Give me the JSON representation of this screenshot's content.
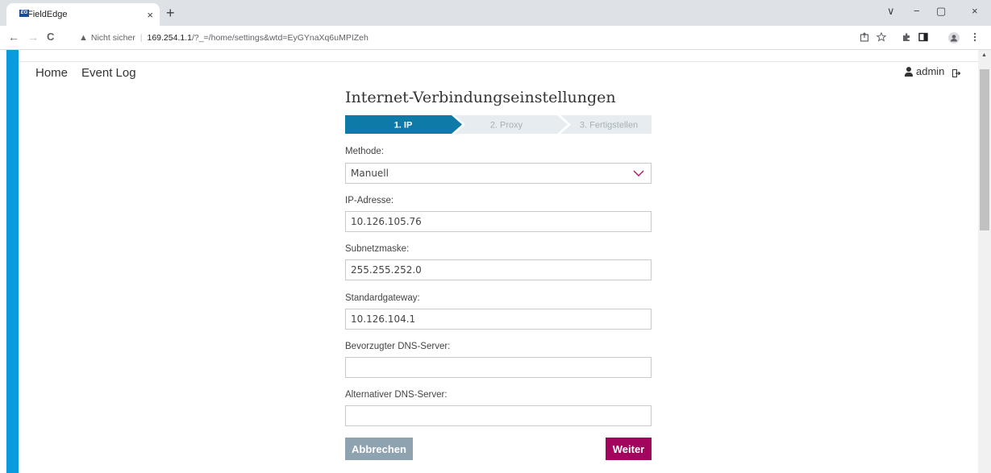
{
  "browser": {
    "tab_title": "FieldEdge",
    "tab_favicon_text": "EG",
    "tab_close": "×",
    "new_tab": "+",
    "back": "←",
    "forward": "→",
    "reload": "C",
    "security_icon": "▲",
    "security_text": "Nicht sicher",
    "separator": "|",
    "url_host": "169.254.1.1",
    "url_path": "/?_=/home/settings&wtd=EyGYnaXq6uMPIZeh",
    "window_controls": {
      "minimize": "−",
      "maximize": "▢",
      "close": "×",
      "tab_search": "∨"
    }
  },
  "nav": {
    "home": "Home",
    "event_log": "Event Log"
  },
  "user": {
    "name": "admin"
  },
  "form": {
    "title": "Internet-Verbindungseinstellungen",
    "steps": [
      {
        "label": "1. IP",
        "active": true
      },
      {
        "label": "2. Proxy",
        "active": false
      },
      {
        "label": "3. Fertigstellen",
        "active": false
      }
    ],
    "method_label": "Methode:",
    "method_value": "Manuell",
    "ip_label": "IP-Adresse:",
    "ip_value": "10.126.105.76",
    "subnet_label": "Subnetzmaske:",
    "subnet_value": "255.255.252.0",
    "gateway_label": "Standardgateway:",
    "gateway_value": "10.126.104.1",
    "dns1_label": "Bevorzugter DNS-Server:",
    "dns1_value": "",
    "dns2_label": "Alternativer DNS-Server:",
    "dns2_value": "",
    "cancel_label": "Abbrechen",
    "next_label": "Weiter"
  },
  "colors": {
    "accent_blue": "#0a9bde",
    "step_active": "#0e7aa8",
    "step_inactive": "#e6ecef",
    "primary_button": "#a3045e",
    "secondary_button": "#8fa2b0"
  }
}
